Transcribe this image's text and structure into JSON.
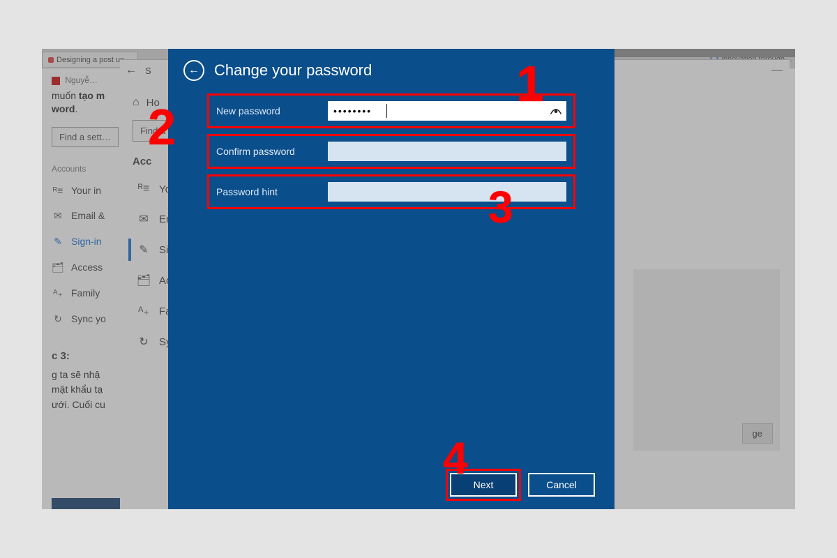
{
  "bg_left": {
    "tab_label": "Designing a post un…",
    "tab_right": "Innovation through…",
    "crumb": "Nguyễ…",
    "desc_prefix": "muốn",
    "desc_bold": "tạo m",
    "desc_line2": "word",
    "find_label": "Find a sett…",
    "section": "Accounts",
    "items": [
      {
        "icon": "person-icon",
        "glyph": "ᴿ≡",
        "label": "Your in"
      },
      {
        "icon": "mail-icon",
        "glyph": "✉",
        "label": "Email &"
      },
      {
        "icon": "key-icon",
        "glyph": "✎",
        "label": "Sign-in",
        "active": true
      },
      {
        "icon": "briefcase-icon",
        "glyph": "🗂",
        "label": "Access"
      },
      {
        "icon": "family-icon",
        "glyph": "ᴬ₊",
        "label": "Family"
      },
      {
        "icon": "sync-icon",
        "glyph": "↻",
        "label": "Sync yo"
      }
    ],
    "step_h": "c 3:",
    "step_p1": "g ta sẽ nhậ",
    "step_p2": "mật khẩu tạ",
    "step_p3": "ưới. Cuối cu"
  },
  "bg_mid": {
    "title_letter": "S",
    "home": "Ho",
    "find_label": "Find a",
    "acc_h": "Acc",
    "items": [
      {
        "icon": "person-icon",
        "glyph": "ᴿ≡",
        "label": "You"
      },
      {
        "icon": "mail-icon",
        "glyph": "✉",
        "label": "Ema"
      },
      {
        "icon": "key-icon",
        "glyph": "✎",
        "label": "Sign",
        "active": true
      },
      {
        "icon": "briefcase-icon",
        "glyph": "🗂",
        "label": "Acc"
      },
      {
        "icon": "family-icon",
        "glyph": "ᴬ₊",
        "label": "Fam"
      },
      {
        "icon": "sync-icon",
        "glyph": "↻",
        "label": "Syn"
      }
    ],
    "change_btn": "ge"
  },
  "dialog": {
    "title": "Change your password",
    "rows": {
      "new_label": "New password",
      "new_value": "••••••••",
      "confirm_label": "Confirm password",
      "confirm_value": "",
      "hint_label": "Password hint",
      "hint_value": ""
    },
    "next": "Next",
    "cancel": "Cancel"
  },
  "annotations": {
    "n1": "1",
    "n2": "2",
    "n3": "3",
    "n4": "4"
  }
}
